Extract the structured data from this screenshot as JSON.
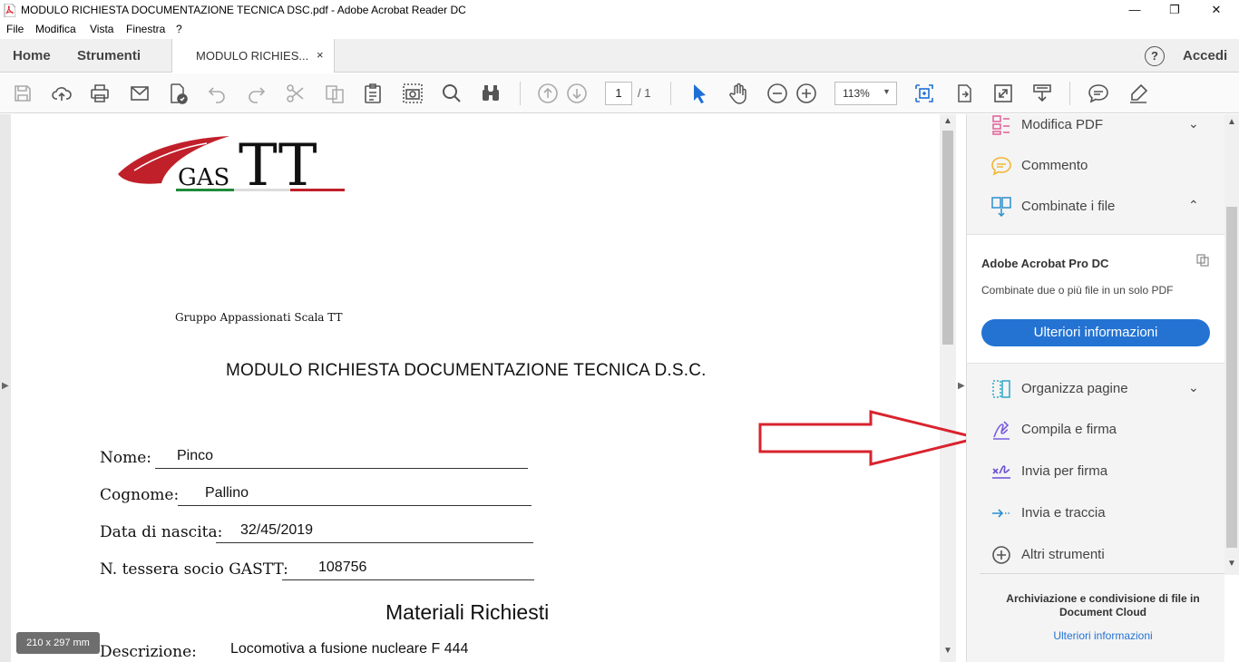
{
  "window": {
    "title": "MODULO RICHIESTA DOCUMENTAZIONE TECNICA DSC.pdf - Adobe Acrobat Reader DC",
    "minimize": "—",
    "maximize": "❐",
    "close": "✕"
  },
  "menu": {
    "items": [
      "File",
      "Modifica",
      "Vista",
      "Finestra",
      "?"
    ]
  },
  "tabs": {
    "home": "Home",
    "tools": "Strumenti",
    "document": "MODULO RICHIES...",
    "close": "×",
    "help": "?",
    "signin": "Accedi"
  },
  "toolbar": {
    "page_current": "1",
    "page_total": "/ 1",
    "zoom": "113%"
  },
  "document": {
    "logo_text_small": "GAS",
    "logo_text_big": "TT",
    "logo_caption": "Gruppo Appassionati Scala TT",
    "title": "MODULO RICHIESTA DOCUMENTAZIONE TECNICA D.S.C.",
    "fields": [
      {
        "label": "Nome:",
        "value": "Pinco"
      },
      {
        "label": "Cognome:",
        "value": "Pallino"
      },
      {
        "label": "Data di nascita:",
        "value": "32/45/2019"
      },
      {
        "label": "N. tessera socio GASTT:",
        "value": "108756"
      }
    ],
    "section_title": "Materiali Richiesti",
    "description_label": "Descrizione:",
    "description_value": "Locomotiva a fusione nucleare F 444",
    "page_size": "210 x 297 mm"
  },
  "right_panel": {
    "items_top": [
      {
        "label": "Modifica PDF",
        "icon": "edit-pdf-icon",
        "chevron": "down"
      },
      {
        "label": "Commento",
        "icon": "comment-icon",
        "chevron": ""
      },
      {
        "label": "Combinate i file",
        "icon": "combine-files-icon",
        "chevron": "up"
      }
    ],
    "promo": {
      "heading": "Adobe Acrobat Pro DC",
      "text": "Combinate due o più file in un solo PDF",
      "button": "Ulteriori informazioni"
    },
    "items_bottom": [
      {
        "label": "Organizza pagine",
        "icon": "organize-pages-icon",
        "chevron": "down"
      },
      {
        "label": "Compila e firma",
        "icon": "fill-sign-icon",
        "chevron": ""
      },
      {
        "label": "Invia per firma",
        "icon": "send-for-signature-icon",
        "chevron": ""
      },
      {
        "label": "Invia e traccia",
        "icon": "send-track-icon",
        "chevron": ""
      },
      {
        "label": "Altri strumenti",
        "icon": "more-tools-icon",
        "chevron": ""
      }
    ],
    "cloud_text": "Archiviazione e condivisione di file in Document Cloud",
    "cloud_link": "Ulteriori informazioni"
  },
  "colors": {
    "accent_blue": "#2473d3",
    "annotation_red": "#d9232e",
    "logo_red": "#c0202a",
    "logo_green": "#1e8c3a"
  }
}
